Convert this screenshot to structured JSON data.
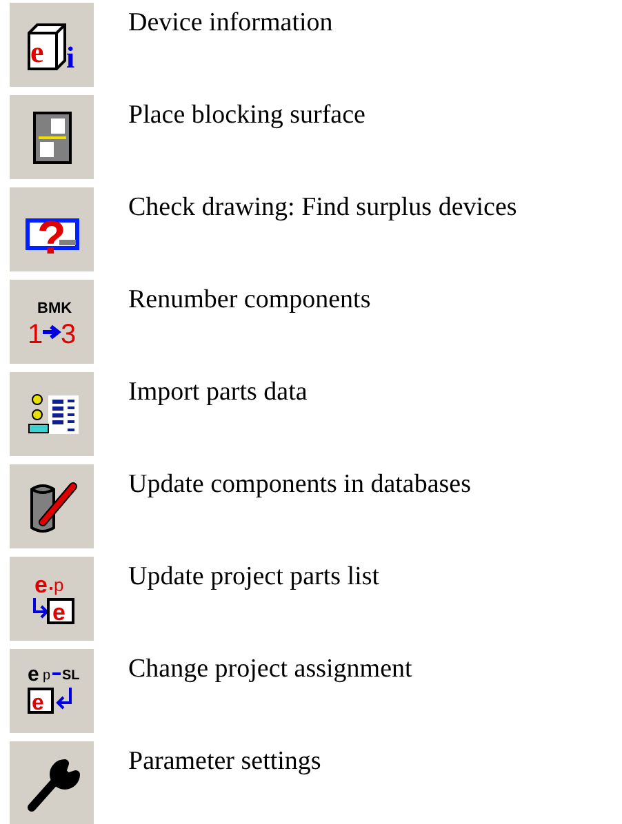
{
  "items": [
    {
      "kind": "device-info",
      "icon_text": [
        "e",
        "i"
      ],
      "label": "Device information"
    },
    {
      "kind": "blocking-surface",
      "label": "Place blocking surface"
    },
    {
      "kind": "check-drawing",
      "icon_text": [
        "?"
      ],
      "label": "Check drawing: Find surplus devices"
    },
    {
      "kind": "renumber",
      "icon_text": [
        "BMK",
        "1",
        "3"
      ],
      "label": "Renumber components"
    },
    {
      "kind": "import-parts",
      "label": "Import parts data"
    },
    {
      "kind": "update-db",
      "label": "Update components in databases"
    },
    {
      "kind": "update-parts-list",
      "icon_text": [
        "e",
        "p",
        "e"
      ],
      "label": "Update project parts list"
    },
    {
      "kind": "change-assignment",
      "icon_text": [
        "e",
        "p",
        "SL",
        "e"
      ],
      "label": "Change project assignment"
    },
    {
      "kind": "parameters",
      "label": "Parameter settings"
    }
  ]
}
